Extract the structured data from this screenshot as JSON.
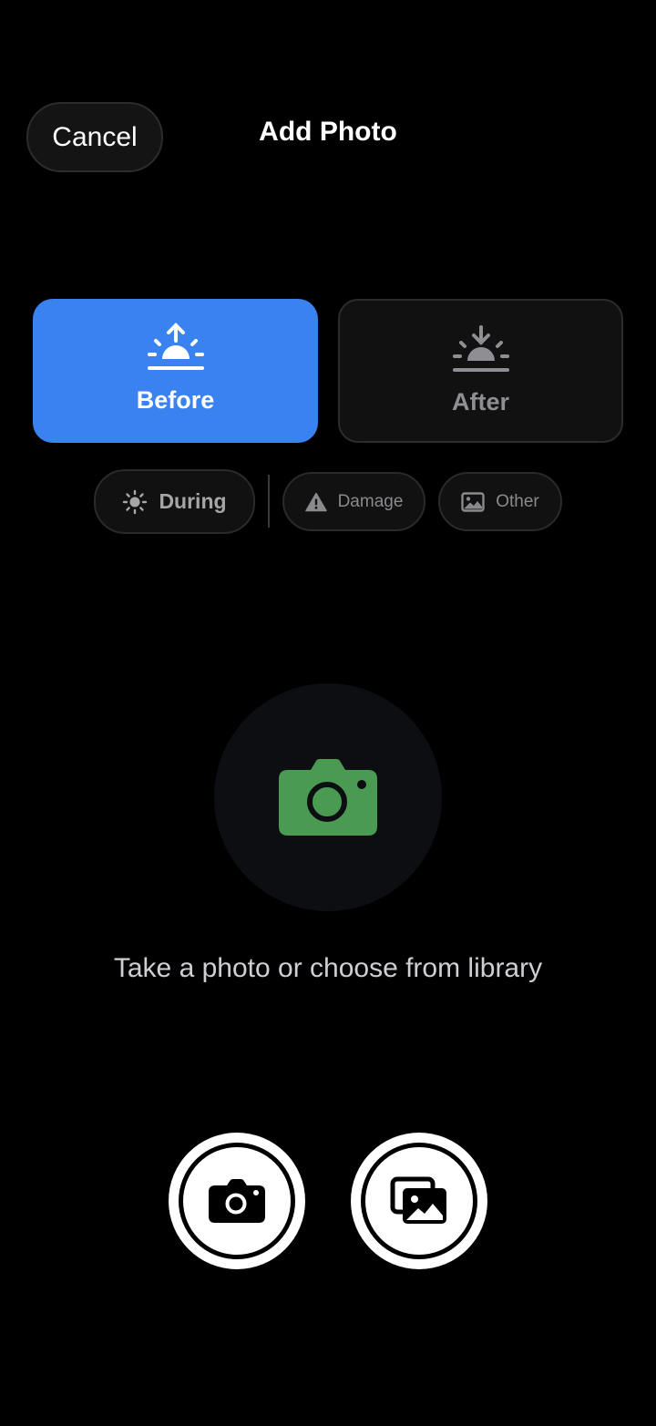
{
  "header": {
    "cancel_label": "Cancel",
    "title": "Add Photo"
  },
  "phases": [
    {
      "label": "Before",
      "icon": "sunrise-icon",
      "selected": true
    },
    {
      "label": "After",
      "icon": "sunset-icon",
      "selected": false
    }
  ],
  "chips": [
    {
      "label": "During",
      "icon": "sun-icon"
    },
    {
      "label": "Damage",
      "icon": "warning-triangle-icon"
    },
    {
      "label": "Other",
      "icon": "photo-icon"
    }
  ],
  "hero": {
    "icon": "camera-icon",
    "hint": "Take a photo or choose from library"
  },
  "actions": [
    {
      "name": "take-photo",
      "icon": "camera-icon"
    },
    {
      "name": "choose-library",
      "icon": "photo-library-icon"
    }
  ],
  "colors": {
    "accent_blue": "#3a82f0",
    "camera_green": "#4a9a52",
    "background": "#000000"
  }
}
